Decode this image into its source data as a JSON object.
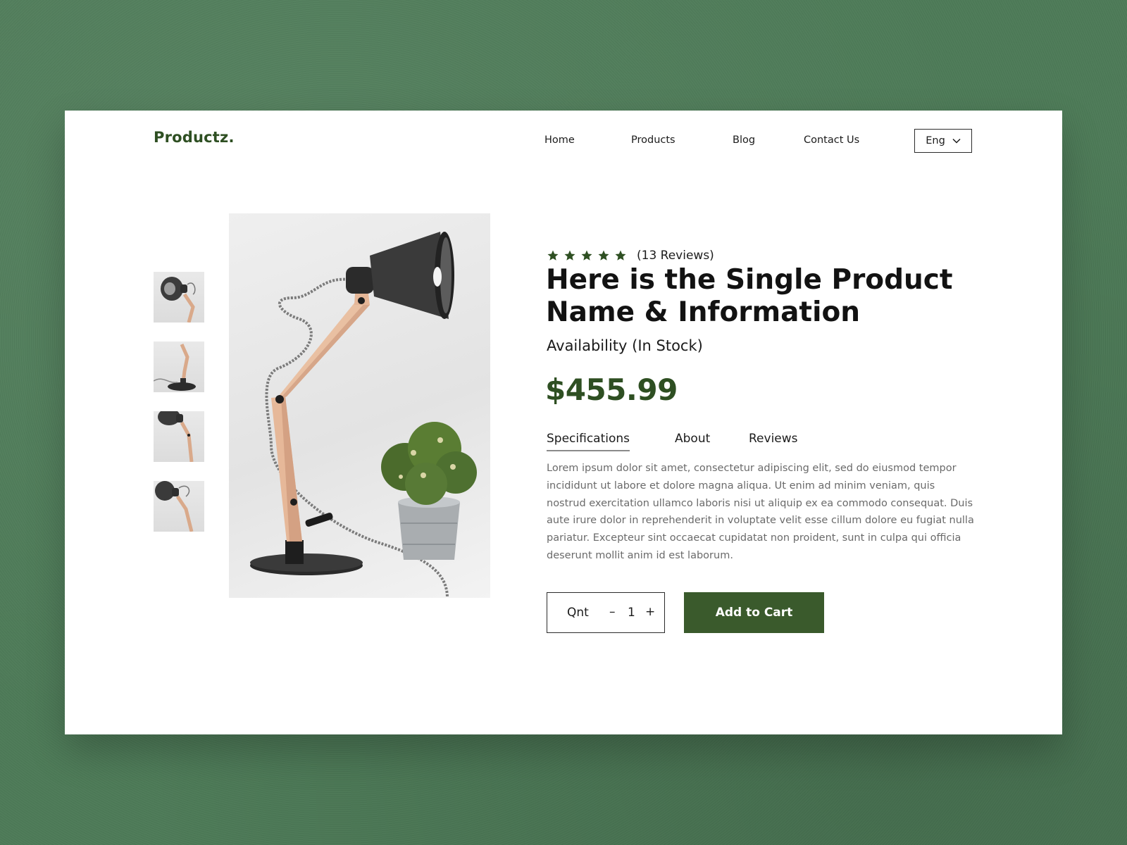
{
  "colors": {
    "background": "#4d7a57",
    "brand": "#2e4f22",
    "button": "#3a5a2c",
    "star": "#2e4f22"
  },
  "header": {
    "logo": "Productz.",
    "nav": [
      "Home",
      "Products",
      "Blog",
      "Contact Us"
    ],
    "language": {
      "selected": "Eng",
      "icon": "chevron-down-icon"
    }
  },
  "gallery": {
    "thumbnails": [
      {
        "label": "lamp-head-closeup"
      },
      {
        "label": "lamp-base-view"
      },
      {
        "label": "lamp-arm-view"
      },
      {
        "label": "lamp-side-view"
      }
    ],
    "main_image": "desk-lamp-with-potted-plant"
  },
  "product": {
    "rating": {
      "stars": 5,
      "max": 5,
      "reviews_text": "(13 Reviews)"
    },
    "title": "Here is the Single Product Name & Information",
    "availability": "Availability (In Stock)",
    "price": "$455.99",
    "tabs": [
      "Specifications",
      "About",
      "Reviews"
    ],
    "active_tab": "Specifications",
    "description": "Lorem ipsum dolor sit amet, consectetur adipiscing elit, sed do eiusmod tempor incididunt ut labore et dolore magna aliqua. Ut enim ad minim veniam, quis nostrud exercitation ullamco laboris nisi ut aliquip ex ea commodo consequat. Duis aute irure dolor in reprehenderit in voluptate velit esse cillum dolore eu fugiat nulla pariatur. Excepteur sint occaecat cupidatat non proident, sunt in culpa qui officia deserunt mollit anim id est laborum."
  },
  "cart": {
    "qty_label": "Qnt",
    "minus": "–",
    "quantity": "1",
    "plus": "+",
    "add_to_cart": "Add to Cart"
  }
}
